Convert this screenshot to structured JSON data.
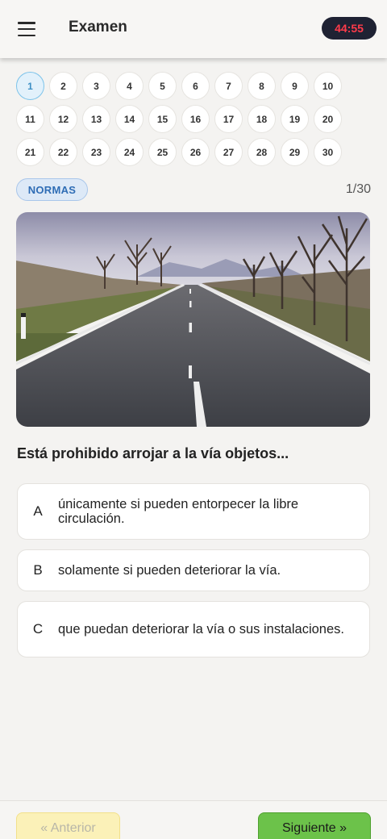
{
  "header": {
    "title": "Examen",
    "timer": "44:55",
    "menu_icon": "hamburger-menu-icon"
  },
  "question_nav": {
    "active": 1,
    "numbers": [
      "1",
      "2",
      "3",
      "4",
      "5",
      "6",
      "7",
      "8",
      "9",
      "10",
      "11",
      "12",
      "13",
      "14",
      "15",
      "16",
      "17",
      "18",
      "19",
      "20",
      "21",
      "22",
      "23",
      "24",
      "25",
      "26",
      "27",
      "28",
      "29",
      "30"
    ]
  },
  "category": "NORMAS",
  "progress": "1/30",
  "question": {
    "text": "Está prohibido arrojar a la vía objetos...",
    "answers": [
      {
        "letter": "A",
        "text": "únicamente si pueden entorpecer la libre circulación."
      },
      {
        "letter": "B",
        "text": "solamente si pueden deteriorar la vía."
      },
      {
        "letter": "C",
        "text": "que puedan deteriorar la vía o sus instalaciones."
      }
    ]
  },
  "footer": {
    "prev_label": "« Anterior",
    "next_label": "Siguiente »"
  },
  "colors": {
    "timer_bg": "#1f2233",
    "timer_text": "#ff3b4a",
    "next_button": "#6cc24a",
    "prev_button": "#fbf1b8",
    "badge_bg": "#dde9f7"
  }
}
